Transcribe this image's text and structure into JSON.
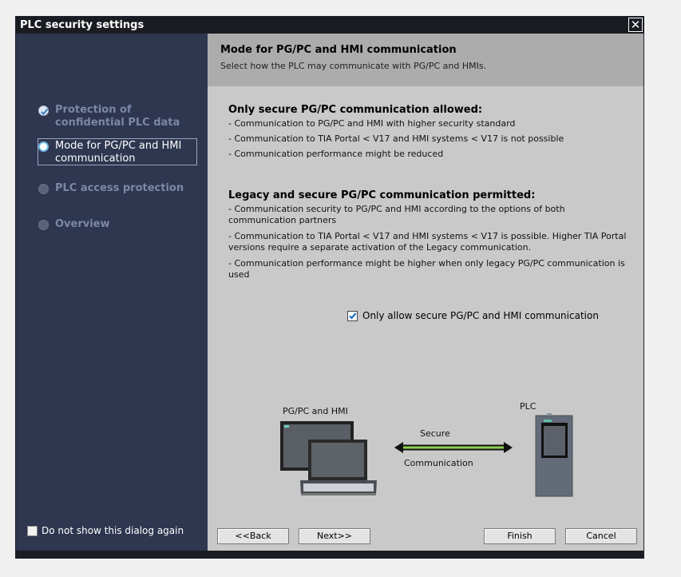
{
  "window": {
    "title": "PLC security settings",
    "close_glyph": "✕"
  },
  "sidebar": {
    "steps": [
      {
        "label": "Protection of confidential PLC data",
        "state": "done"
      },
      {
        "label": "Mode for PG/PC and HMI communication",
        "state": "current"
      },
      {
        "label": "PLC access protection",
        "state": "pending"
      },
      {
        "label": "Overview",
        "state": "pending"
      }
    ],
    "dont_show_label": "Do not show this dialog again",
    "dont_show_checked": false
  },
  "header": {
    "title": "Mode for PG/PC and HMI communication",
    "subtitle": "Select how the PLC may communicate with PG/PC and HMIs."
  },
  "sections": {
    "secure": {
      "title": "Only secure PG/PC communication allowed:",
      "bullets": [
        "- Communication to PG/PC and HMI with higher security standard",
        "- Communication to TIA Portal < V17 and HMI systems < V17 is not possible",
        "- Communication performance might be reduced"
      ]
    },
    "legacy": {
      "title": "Legacy and secure PG/PC communication permitted:",
      "bullets": [
        "- Communication security to PG/PC and HMI according to the options of both communication partners",
        "- Communication to TIA Portal < V17 and HMI systems < V17 is possible. Higher TIA Portal versions require a separate activation of the Legacy communication.",
        "- Communication performance might be higher when only legacy PG/PC communication is used"
      ]
    }
  },
  "option": {
    "label": "Only allow secure PG/PC and HMI communication",
    "checked": true
  },
  "diagram": {
    "left_label": "PG/PC and HMI",
    "right_label": "PLC",
    "arrow_top_label": "Secure",
    "arrow_bottom_label": "Communication",
    "arrow_color": "#8fd14f"
  },
  "buttons": {
    "back": "<<Back",
    "next": "Next>>",
    "finish": "Finish",
    "cancel": "Cancel"
  },
  "colors": {
    "sidebar_bg": "#2e3650",
    "content_bg": "#c9c9c9",
    "header_bg": "#acacac",
    "accent": "#6fb8e6"
  }
}
